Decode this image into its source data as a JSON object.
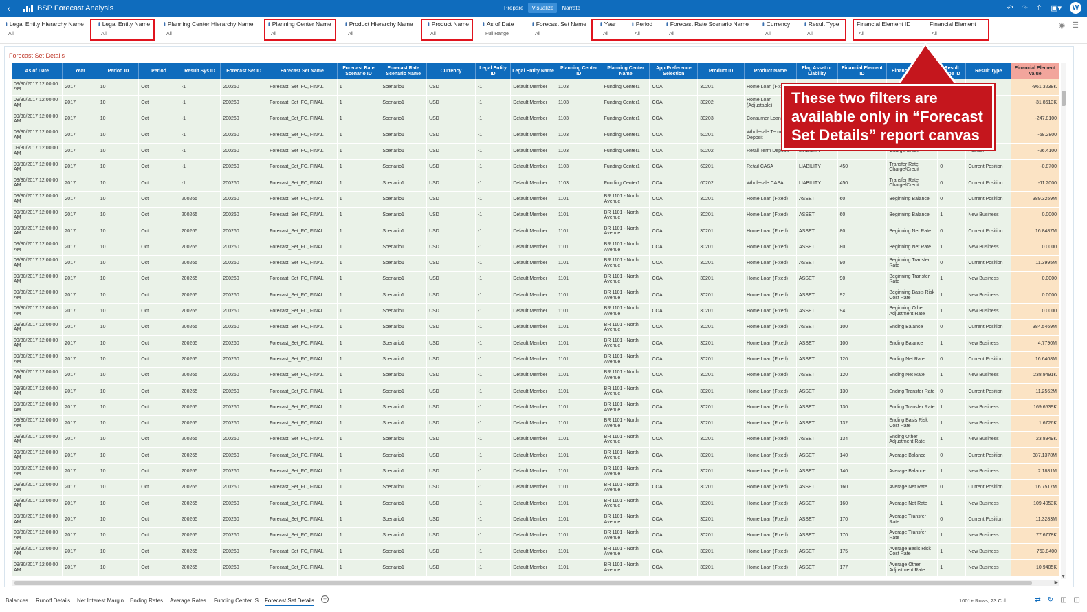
{
  "app": {
    "title": "BSP Forecast Analysis",
    "modes": [
      "Prepare",
      "Visualize",
      "Narrate"
    ],
    "active_mode": "Visualize",
    "avatar_initial": "W"
  },
  "filters": [
    {
      "label": "Legal Entity Hierarchy Name",
      "value": "All"
    },
    {
      "label": "Legal Entity Name",
      "value": "All"
    },
    {
      "label": "Planning Center Hierarchy Name",
      "value": "All"
    },
    {
      "label": "Planning Center Name",
      "value": "All"
    },
    {
      "label": "Product Hierarchy Name",
      "value": "All"
    },
    {
      "label": "Product Name",
      "value": "All"
    },
    {
      "label": "As of Date",
      "value": "Full Range"
    },
    {
      "label": "Forecast Set Name",
      "value": "All"
    },
    {
      "label": "Year",
      "value": "All"
    },
    {
      "label": "Period",
      "value": "All"
    },
    {
      "label": "Forecast Rate Scenario Name",
      "value": "All"
    },
    {
      "label": "Currency",
      "value": "All"
    },
    {
      "label": "Result Type",
      "value": "All"
    },
    {
      "label": "Financial Element ID",
      "value": "All"
    },
    {
      "label": "Financial Element",
      "value": "All"
    }
  ],
  "canvas": {
    "title": "Forecast Set Details"
  },
  "table": {
    "columns": [
      "As of Date",
      "Year",
      "Period ID",
      "Period",
      "Result Sys ID",
      "Forecast Set ID",
      "Forecast Set Name",
      "Forecast Rate Scenario ID",
      "Forecast Rate Scenario Name",
      "Currency",
      "Legal Entity ID",
      "Legal Entity Name",
      "Planning Center ID",
      "Planning Center Name",
      "App Preference Selection",
      "Product ID",
      "Product Name",
      "Flag Asset or Liability",
      "Financial Element ID",
      "Financial Element",
      "Result Type ID",
      "Result Type",
      "Financial Element Value"
    ],
    "rows": [
      [
        "09/30/2017 12:00:00 AM",
        "2017",
        "10",
        "Oct",
        "-1",
        "200260",
        "Forecast_Set_FC, FINAL",
        "1",
        "Scenario1",
        "USD",
        "-1",
        "Default Member",
        "1103",
        "Funding Center1",
        "COA",
        "30201",
        "Home Loan (Fixed)",
        "",
        "",
        "",
        "",
        "",
        "-961.3238K"
      ],
      [
        "09/30/2017 12:00:00 AM",
        "2017",
        "10",
        "Oct",
        "-1",
        "200260",
        "Forecast_Set_FC, FINAL",
        "1",
        "Scenario1",
        "USD",
        "-1",
        "Default Member",
        "1103",
        "Funding Center1",
        "COA",
        "30202",
        "Home Loan (Adjustable)",
        "",
        "",
        "",
        "",
        "",
        "-31.8613K"
      ],
      [
        "09/30/2017 12:00:00 AM",
        "2017",
        "10",
        "Oct",
        "-1",
        "200260",
        "Forecast_Set_FC, FINAL",
        "1",
        "Scenario1",
        "USD",
        "-1",
        "Default Member",
        "1103",
        "Funding Center1",
        "COA",
        "30203",
        "Consumer Loan",
        "",
        "",
        "",
        "",
        "",
        "-247.8100"
      ],
      [
        "09/30/2017 12:00:00 AM",
        "2017",
        "10",
        "Oct",
        "-1",
        "200260",
        "Forecast_Set_FC, FINAL",
        "1",
        "Scenario1",
        "USD",
        "-1",
        "Default Member",
        "1103",
        "Funding Center1",
        "COA",
        "50201",
        "Wholesale Term Deposit",
        "",
        "",
        "",
        "",
        "",
        "-58.2800"
      ],
      [
        "09/30/2017 12:00:00 AM",
        "2017",
        "10",
        "Oct",
        "-1",
        "200260",
        "Forecast_Set_FC, FINAL",
        "1",
        "Scenario1",
        "USD",
        "-1",
        "Default Member",
        "1103",
        "Funding Center1",
        "COA",
        "50202",
        "Retail Term Deposit",
        "LIABILITY",
        "",
        "Charge/Credit",
        "",
        "Position",
        "-26.4100"
      ],
      [
        "09/30/2017 12:00:00 AM",
        "2017",
        "10",
        "Oct",
        "-1",
        "200260",
        "Forecast_Set_FC, FINAL",
        "1",
        "Scenario1",
        "USD",
        "-1",
        "Default Member",
        "1103",
        "Funding Center1",
        "COA",
        "60201",
        "Retail CASA",
        "LIABILITY",
        "450",
        "Transfer Rate Charge/Credit",
        "0",
        "Current Position",
        "-0.8700"
      ],
      [
        "09/30/2017 12:00:00 AM",
        "2017",
        "10",
        "Oct",
        "-1",
        "200260",
        "Forecast_Set_FC, FINAL",
        "1",
        "Scenario1",
        "USD",
        "-1",
        "Default Member",
        "1103",
        "Funding Center1",
        "COA",
        "60202",
        "Wholesale CASA",
        "LIABILITY",
        "450",
        "Transfer Rate Charge/Credit",
        "0",
        "Current Position",
        "-11.2000"
      ],
      [
        "09/30/2017 12:00:00 AM",
        "2017",
        "10",
        "Oct",
        "200265",
        "200260",
        "Forecast_Set_FC, FINAL",
        "1",
        "Scenario1",
        "USD",
        "-1",
        "Default Member",
        "1101",
        "BR 1101 - North Avenue",
        "COA",
        "30201",
        "Home Loan (Fixed)",
        "ASSET",
        "60",
        "Beginning Balance",
        "0",
        "Current Position",
        "389.3259M"
      ],
      [
        "09/30/2017 12:00:00 AM",
        "2017",
        "10",
        "Oct",
        "200265",
        "200260",
        "Forecast_Set_FC, FINAL",
        "1",
        "Scenario1",
        "USD",
        "-1",
        "Default Member",
        "1101",
        "BR 1101 - North Avenue",
        "COA",
        "30201",
        "Home Loan (Fixed)",
        "ASSET",
        "60",
        "Beginning Balance",
        "1",
        "New Business",
        "0.0000"
      ],
      [
        "09/30/2017 12:00:00 AM",
        "2017",
        "10",
        "Oct",
        "200265",
        "200260",
        "Forecast_Set_FC, FINAL",
        "1",
        "Scenario1",
        "USD",
        "-1",
        "Default Member",
        "1101",
        "BR 1101 - North Avenue",
        "COA",
        "30201",
        "Home Loan (Fixed)",
        "ASSET",
        "80",
        "Beginning Net Rate",
        "0",
        "Current Position",
        "16.8487M"
      ],
      [
        "09/30/2017 12:00:00 AM",
        "2017",
        "10",
        "Oct",
        "200265",
        "200260",
        "Forecast_Set_FC, FINAL",
        "1",
        "Scenario1",
        "USD",
        "-1",
        "Default Member",
        "1101",
        "BR 1101 - North Avenue",
        "COA",
        "30201",
        "Home Loan (Fixed)",
        "ASSET",
        "80",
        "Beginning Net Rate",
        "1",
        "New Business",
        "0.0000"
      ],
      [
        "09/30/2017 12:00:00 AM",
        "2017",
        "10",
        "Oct",
        "200265",
        "200260",
        "Forecast_Set_FC, FINAL",
        "1",
        "Scenario1",
        "USD",
        "-1",
        "Default Member",
        "1101",
        "BR 1101 - North Avenue",
        "COA",
        "30201",
        "Home Loan (Fixed)",
        "ASSET",
        "90",
        "Beginning Transfer Rate",
        "0",
        "Current Position",
        "11.3995M"
      ],
      [
        "09/30/2017 12:00:00 AM",
        "2017",
        "10",
        "Oct",
        "200265",
        "200260",
        "Forecast_Set_FC, FINAL",
        "1",
        "Scenario1",
        "USD",
        "-1",
        "Default Member",
        "1101",
        "BR 1101 - North Avenue",
        "COA",
        "30201",
        "Home Loan (Fixed)",
        "ASSET",
        "90",
        "Beginning Transfer Rate",
        "1",
        "New Business",
        "0.0000"
      ],
      [
        "09/30/2017 12:00:00 AM",
        "2017",
        "10",
        "Oct",
        "200265",
        "200260",
        "Forecast_Set_FC, FINAL",
        "1",
        "Scenario1",
        "USD",
        "-1",
        "Default Member",
        "1101",
        "BR 1101 - North Avenue",
        "COA",
        "30201",
        "Home Loan (Fixed)",
        "ASSET",
        "92",
        "Beginning Basis Risk Cost Rate",
        "1",
        "New Business",
        "0.0000"
      ],
      [
        "09/30/2017 12:00:00 AM",
        "2017",
        "10",
        "Oct",
        "200265",
        "200260",
        "Forecast_Set_FC, FINAL",
        "1",
        "Scenario1",
        "USD",
        "-1",
        "Default Member",
        "1101",
        "BR 1101 - North Avenue",
        "COA",
        "30201",
        "Home Loan (Fixed)",
        "ASSET",
        "94",
        "Beginning Other Adjustment Rate",
        "1",
        "New Business",
        "0.0000"
      ],
      [
        "09/30/2017 12:00:00 AM",
        "2017",
        "10",
        "Oct",
        "200265",
        "200260",
        "Forecast_Set_FC, FINAL",
        "1",
        "Scenario1",
        "USD",
        "-1",
        "Default Member",
        "1101",
        "BR 1101 - North Avenue",
        "COA",
        "30201",
        "Home Loan (Fixed)",
        "ASSET",
        "100",
        "Ending Balance",
        "0",
        "Current Position",
        "384.5469M"
      ],
      [
        "09/30/2017 12:00:00 AM",
        "2017",
        "10",
        "Oct",
        "200265",
        "200260",
        "Forecast_Set_FC, FINAL",
        "1",
        "Scenario1",
        "USD",
        "-1",
        "Default Member",
        "1101",
        "BR 1101 - North Avenue",
        "COA",
        "30201",
        "Home Loan (Fixed)",
        "ASSET",
        "100",
        "Ending Balance",
        "1",
        "New Business",
        "4.7790M"
      ],
      [
        "09/30/2017 12:00:00 AM",
        "2017",
        "10",
        "Oct",
        "200265",
        "200260",
        "Forecast_Set_FC, FINAL",
        "1",
        "Scenario1",
        "USD",
        "-1",
        "Default Member",
        "1101",
        "BR 1101 - North Avenue",
        "COA",
        "30201",
        "Home Loan (Fixed)",
        "ASSET",
        "120",
        "Ending Net Rate",
        "0",
        "Current Position",
        "16.6408M"
      ],
      [
        "09/30/2017 12:00:00 AM",
        "2017",
        "10",
        "Oct",
        "200265",
        "200260",
        "Forecast_Set_FC, FINAL",
        "1",
        "Scenario1",
        "USD",
        "-1",
        "Default Member",
        "1101",
        "BR 1101 - North Avenue",
        "COA",
        "30201",
        "Home Loan (Fixed)",
        "ASSET",
        "120",
        "Ending Net Rate",
        "1",
        "New Business",
        "238.9491K"
      ],
      [
        "09/30/2017 12:00:00 AM",
        "2017",
        "10",
        "Oct",
        "200265",
        "200260",
        "Forecast_Set_FC, FINAL",
        "1",
        "Scenario1",
        "USD",
        "-1",
        "Default Member",
        "1101",
        "BR 1101 - North Avenue",
        "COA",
        "30201",
        "Home Loan (Fixed)",
        "ASSET",
        "130",
        "Ending Transfer Rate",
        "0",
        "Current Position",
        "11.2562M"
      ],
      [
        "09/30/2017 12:00:00 AM",
        "2017",
        "10",
        "Oct",
        "200265",
        "200260",
        "Forecast_Set_FC, FINAL",
        "1",
        "Scenario1",
        "USD",
        "-1",
        "Default Member",
        "1101",
        "BR 1101 - North Avenue",
        "COA",
        "30201",
        "Home Loan (Fixed)",
        "ASSET",
        "130",
        "Ending Transfer Rate",
        "1",
        "New Business",
        "169.6539K"
      ],
      [
        "09/30/2017 12:00:00 AM",
        "2017",
        "10",
        "Oct",
        "200265",
        "200260",
        "Forecast_Set_FC, FINAL",
        "1",
        "Scenario1",
        "USD",
        "-1",
        "Default Member",
        "1101",
        "BR 1101 - North Avenue",
        "COA",
        "30201",
        "Home Loan (Fixed)",
        "ASSET",
        "132",
        "Ending Basis Risk Cost Rate",
        "1",
        "New Business",
        "1.6726K"
      ],
      [
        "09/30/2017 12:00:00 AM",
        "2017",
        "10",
        "Oct",
        "200265",
        "200260",
        "Forecast_Set_FC, FINAL",
        "1",
        "Scenario1",
        "USD",
        "-1",
        "Default Member",
        "1101",
        "BR 1101 - North Avenue",
        "COA",
        "30201",
        "Home Loan (Fixed)",
        "ASSET",
        "134",
        "Ending Other Adjustment Rate",
        "1",
        "New Business",
        "23.8949K"
      ],
      [
        "09/30/2017 12:00:00 AM",
        "2017",
        "10",
        "Oct",
        "200265",
        "200260",
        "Forecast_Set_FC, FINAL",
        "1",
        "Scenario1",
        "USD",
        "-1",
        "Default Member",
        "1101",
        "BR 1101 - North Avenue",
        "COA",
        "30201",
        "Home Loan (Fixed)",
        "ASSET",
        "140",
        "Average Balance",
        "0",
        "Current Position",
        "387.1378M"
      ],
      [
        "09/30/2017 12:00:00 AM",
        "2017",
        "10",
        "Oct",
        "200265",
        "200260",
        "Forecast_Set_FC, FINAL",
        "1",
        "Scenario1",
        "USD",
        "-1",
        "Default Member",
        "1101",
        "BR 1101 - North Avenue",
        "COA",
        "30201",
        "Home Loan (Fixed)",
        "ASSET",
        "140",
        "Average Balance",
        "1",
        "New Business",
        "2.1881M"
      ],
      [
        "09/30/2017 12:00:00 AM",
        "2017",
        "10",
        "Oct",
        "200265",
        "200260",
        "Forecast_Set_FC, FINAL",
        "1",
        "Scenario1",
        "USD",
        "-1",
        "Default Member",
        "1101",
        "BR 1101 - North Avenue",
        "COA",
        "30201",
        "Home Loan (Fixed)",
        "ASSET",
        "160",
        "Average Net Rate",
        "0",
        "Current Position",
        "16.7517M"
      ],
      [
        "09/30/2017 12:00:00 AM",
        "2017",
        "10",
        "Oct",
        "200265",
        "200260",
        "Forecast_Set_FC, FINAL",
        "1",
        "Scenario1",
        "USD",
        "-1",
        "Default Member",
        "1101",
        "BR 1101 - North Avenue",
        "COA",
        "30201",
        "Home Loan (Fixed)",
        "ASSET",
        "160",
        "Average Net Rate",
        "1",
        "New Business",
        "109.4053K"
      ],
      [
        "09/30/2017 12:00:00 AM",
        "2017",
        "10",
        "Oct",
        "200265",
        "200260",
        "Forecast_Set_FC, FINAL",
        "1",
        "Scenario1",
        "USD",
        "-1",
        "Default Member",
        "1101",
        "BR 1101 - North Avenue",
        "COA",
        "30201",
        "Home Loan (Fixed)",
        "ASSET",
        "170",
        "Average Transfer Rate",
        "0",
        "Current Position",
        "11.3283M"
      ],
      [
        "09/30/2017 12:00:00 AM",
        "2017",
        "10",
        "Oct",
        "200265",
        "200260",
        "Forecast_Set_FC, FINAL",
        "1",
        "Scenario1",
        "USD",
        "-1",
        "Default Member",
        "1101",
        "BR 1101 - North Avenue",
        "COA",
        "30201",
        "Home Loan (Fixed)",
        "ASSET",
        "170",
        "Average Transfer Rate",
        "1",
        "New Business",
        "77.6778K"
      ],
      [
        "09/30/2017 12:00:00 AM",
        "2017",
        "10",
        "Oct",
        "200265",
        "200260",
        "Forecast_Set_FC, FINAL",
        "1",
        "Scenario1",
        "USD",
        "-1",
        "Default Member",
        "1101",
        "BR 1101 - North Avenue",
        "COA",
        "30201",
        "Home Loan (Fixed)",
        "ASSET",
        "175",
        "Average Basis Risk Cost Rate",
        "1",
        "New Business",
        "763.8400"
      ],
      [
        "09/30/2017 12:00:00 AM",
        "2017",
        "10",
        "Oct",
        "200265",
        "200260",
        "Forecast_Set_FC, FINAL",
        "1",
        "Scenario1",
        "USD",
        "-1",
        "Default Member",
        "1101",
        "BR 1101 - North Avenue",
        "COA",
        "30201",
        "Home Loan (Fixed)",
        "ASSET",
        "177",
        "Average Other Adjustment Rate",
        "1",
        "New Business",
        "10.9405K"
      ]
    ]
  },
  "callout": {
    "text": "These two filters are available only in “Forecast Set Details” report canvas"
  },
  "tabs": [
    "Balances",
    "Runoff Details",
    "Net Interest Margin",
    "Ending Rates",
    "Average Rates",
    "Funding Center IS",
    "Forecast Set Details"
  ],
  "active_tab": "Forecast Set Details",
  "status": {
    "row_info": "1001+ Rows, 23 Col..."
  },
  "colors": {
    "header_blue": "#0f6cbd",
    "highlight_red": "#e0141e",
    "row_green": "#eaf2e8",
    "value_orange": "#fbe3c4"
  }
}
